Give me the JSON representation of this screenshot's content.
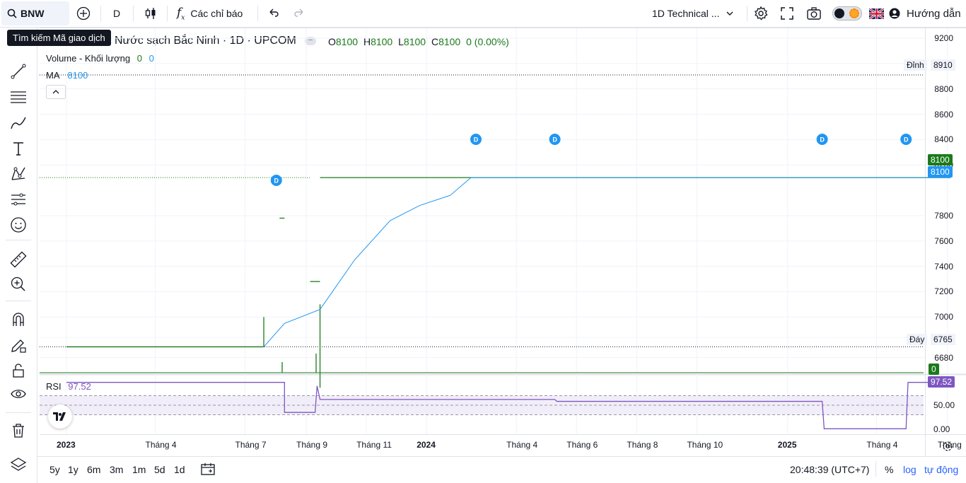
{
  "topbar": {
    "symbol": "BNW",
    "interval": "D",
    "indicators_label": "Các chỉ báo",
    "layout_name": "1D Technical ...",
    "guide_label": "Hướng dẫn"
  },
  "tooltip": "Tìm kiếm Mã giao dịch",
  "legend": {
    "title": "Nước sạch Bắc Ninh · 1D · UPCOM",
    "o_label": "O",
    "o_value": "8100",
    "h_label": "H",
    "h_value": "8100",
    "l_label": "L",
    "l_value": "8100",
    "c_label": "C",
    "c_value": "8100",
    "change": "0 (0.00%)",
    "volume_label": "Volume - Khối lượng",
    "volume_v1": "0",
    "volume_v2": "0",
    "ma_label": "MA",
    "ma_value": "8100"
  },
  "price_axis": {
    "ticks": [
      "9200",
      "9000",
      "8800",
      "8600",
      "8400",
      "8200",
      "7800",
      "7600",
      "7400",
      "7200",
      "7000",
      "6840",
      "6680"
    ],
    "high_label": "Đỉnh",
    "high_value": "8910",
    "low_label": "Đáy",
    "low_value": "6765",
    "last_price": "8100",
    "ma_price": "8100",
    "volume_tag": "0"
  },
  "rsi": {
    "label": "RSI",
    "value": "97.52",
    "ticks": [
      "50.00",
      "0.00"
    ]
  },
  "time_axis": [
    "2023",
    "Tháng 4",
    "Tháng 7",
    "Tháng 9",
    "Tháng 11",
    "2024",
    "Tháng 4",
    "Tháng 6",
    "Tháng 8",
    "Tháng 10",
    "2025",
    "Tháng 4",
    "Tháng"
  ],
  "dividend_marker": "D",
  "bottom": {
    "ranges": [
      "5y",
      "1y",
      "6m",
      "3m",
      "1m",
      "5d",
      "1d"
    ],
    "clock": "20:48:39 (UTC+7)",
    "percent": "%",
    "log": "log",
    "auto": "tự động"
  },
  "colors": {
    "price_line": "#1b7a1b",
    "ma_line": "#2196f3",
    "rsi_line": "#7e57c2",
    "rsi_band": "#ede7f6"
  },
  "chart_data": [
    {
      "type": "line",
      "title": "Nước sạch Bắc Ninh · 1D · UPCOM",
      "ylim": [
        6600,
        9250
      ],
      "series": [
        {
          "name": "Price",
          "x": [
            "2023-01-01",
            "2023-07-20",
            "2023-07-20",
            "2023-08-05",
            "2023-08-10",
            "2023-09-05",
            "2023-09-15",
            "2023-09-15",
            "2025-06-15"
          ],
          "values": [
            6765,
            6765,
            7000,
            7780,
            7780,
            7280,
            7280,
            8100,
            8100
          ]
        },
        {
          "name": "MA",
          "x": [
            "2023-07-20",
            "2023-08-10",
            "2023-09-15",
            "2023-10-20",
            "2023-11-25",
            "2023-12-25",
            "2024-01-25",
            "2024-02-15",
            "2025-06-15"
          ],
          "values": [
            6765,
            6950,
            7060,
            7450,
            7760,
            7880,
            7960,
            8100,
            8100
          ]
        }
      ],
      "high": 8910,
      "low": 6765,
      "dividend_dates": [
        "2023-08-01",
        "2024-02-20",
        "2024-05-10",
        "2025-02-05",
        "2025-05-01"
      ]
    },
    {
      "type": "line",
      "ylim": [
        0,
        100
      ],
      "series": [
        {
          "name": "RSI",
          "x": [
            "2023-01-01",
            "2023-08-10",
            "2023-08-10",
            "2023-09-10",
            "2023-09-12",
            "2023-09-15",
            "2024-05-10",
            "2024-05-12",
            "2025-02-05",
            "2025-02-07",
            "2025-05-01",
            "2025-05-03",
            "2025-06-15"
          ],
          "values": [
            97.52,
            97.52,
            35,
            35,
            90,
            62,
            62,
            58,
            58,
            1,
            1,
            97.52,
            97.52
          ]
        }
      ],
      "bands": [
        30,
        50,
        70
      ]
    }
  ]
}
